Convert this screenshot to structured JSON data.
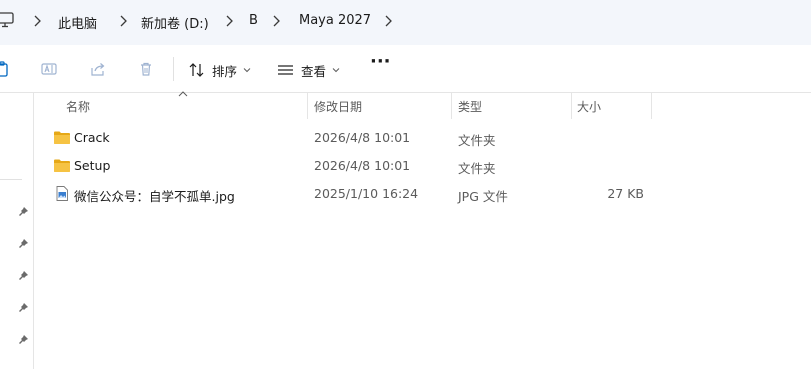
{
  "breadcrumb": {
    "items": [
      "此电脑",
      "新加卷 (D:)",
      "B",
      "Maya 2027"
    ]
  },
  "toolbar": {
    "sort_label": "排序",
    "view_label": "查看",
    "more_label": "···"
  },
  "columns": {
    "name": "名称",
    "date": "修改日期",
    "type": "类型",
    "size": "大小"
  },
  "files": [
    {
      "name": "Crack",
      "date": "2026/4/8 10:01",
      "type": "文件夹",
      "size": "",
      "icon": "folder-icon"
    },
    {
      "name": "Setup",
      "date": "2026/4/8 10:01",
      "type": "文件夹",
      "size": "",
      "icon": "folder-icon"
    },
    {
      "name": "微信公众号：自学不孤单.jpg",
      "date": "2025/1/10 16:24",
      "type": "JPG 文件",
      "size": "27 KB",
      "icon": "image-file-icon"
    }
  ],
  "colors": {
    "address_bg": "#f3f6fb",
    "folder": "#f6c343",
    "folder_dark": "#e6a817",
    "accent": "#0067c0"
  }
}
